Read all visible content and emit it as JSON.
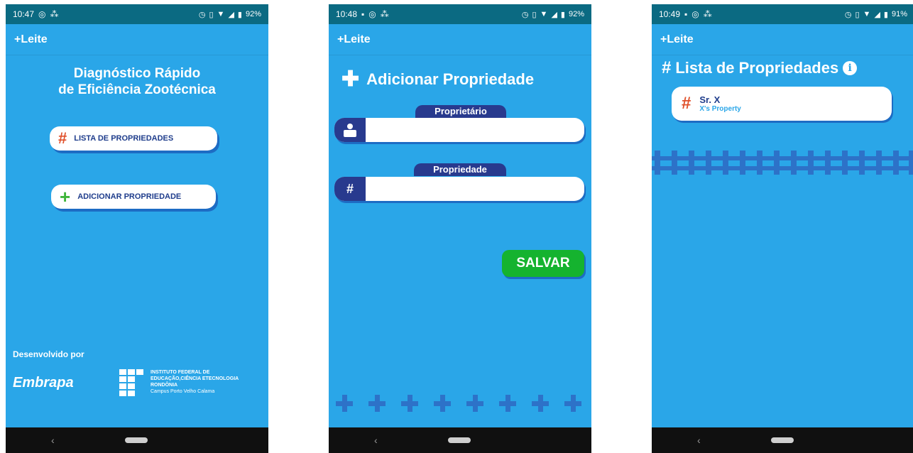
{
  "screens": [
    {
      "status": {
        "time": "10:47",
        "battery": "92%"
      },
      "appbar_title": "+Leite",
      "title_line1": "Diagnóstico Rápido",
      "title_line2": "de Eficiência Zootécnica",
      "btn_list": "LISTA DE PROPRIEDADES",
      "btn_add": "ADICIONAR PROPRIEDADE",
      "dev_label": "Desenvolvido por",
      "embrapa": "Embrapa",
      "if_line1": "INSTITUTO FEDERAL DE",
      "if_line2": "EDUCAÇÃO,CIÊNCIA ETECNOLOGIA",
      "if_line3": "RONDÔNIA",
      "if_line4": "Campus Porto Velho Calama"
    },
    {
      "status": {
        "time": "10:48",
        "battery": "92%"
      },
      "appbar_title": "+Leite",
      "title": "Adicionar Propriedade",
      "label_owner": "Proprietário",
      "label_property": "Propriedade",
      "owner_value": "",
      "property_value": "",
      "save": "SALVAR"
    },
    {
      "status": {
        "time": "10:49",
        "battery": "91%"
      },
      "appbar_title": "+Leite",
      "title": "Lista de Propriedades",
      "items": [
        {
          "owner": "Sr. X",
          "property": "X's Property"
        }
      ]
    }
  ],
  "colors": {
    "background": "#2aa6e8",
    "statusbar": "#0b6a82",
    "accent_dark": "#283a8e",
    "save_green": "#15b32f",
    "hash_orange": "#e0502a"
  }
}
